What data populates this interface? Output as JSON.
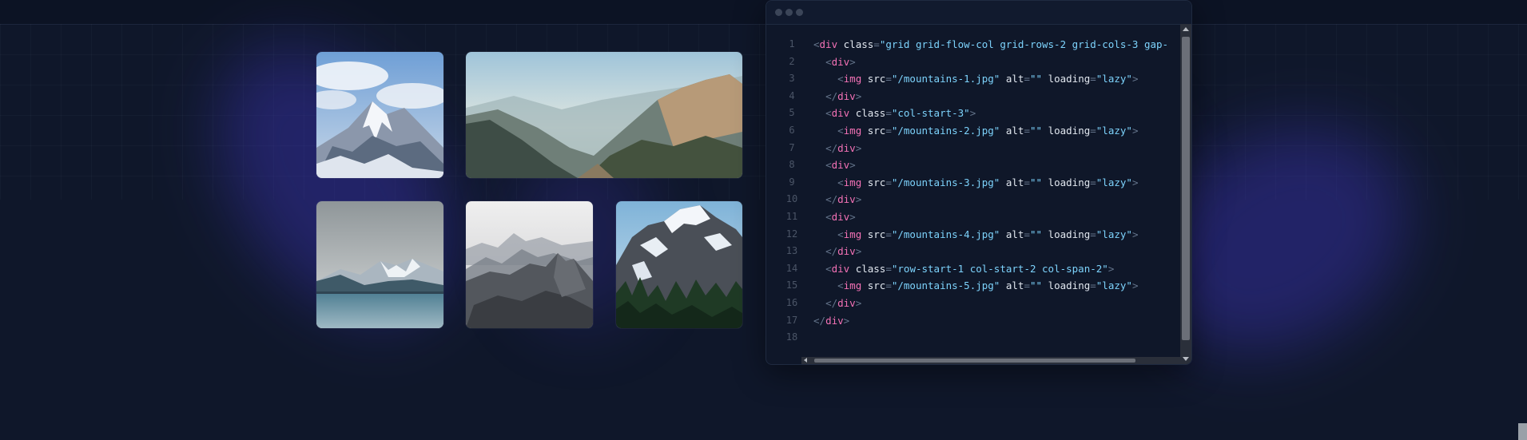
{
  "gallery": {
    "images": [
      {
        "name": "mountains-1",
        "description": "snow-capped peak under cloudy blue sky"
      },
      {
        "name": "mountains-2",
        "description": "sunlit mountain valley panorama"
      },
      {
        "name": "mountains-3",
        "description": "lake with distant snowy mountains"
      },
      {
        "name": "mountains-4",
        "description": "misty rocky ridge"
      },
      {
        "name": "mountains-5",
        "description": "snowy peak above pine forest"
      }
    ]
  },
  "editor": {
    "lines": [
      {
        "n": "1",
        "tokens": [
          [
            "punc",
            "<"
          ],
          [
            "tag",
            "div"
          ],
          [
            "sp",
            " "
          ],
          [
            "attr",
            "class"
          ],
          [
            "eq",
            "="
          ],
          [
            "str",
            "\"grid grid-flow-col grid-rows-2 grid-cols-3 gap-"
          ]
        ]
      },
      {
        "n": "2",
        "tokens": [
          [
            "sp",
            "  "
          ],
          [
            "punc",
            "<"
          ],
          [
            "tag",
            "div"
          ],
          [
            "punc",
            ">"
          ]
        ]
      },
      {
        "n": "3",
        "tokens": [
          [
            "sp",
            "    "
          ],
          [
            "punc",
            "<"
          ],
          [
            "tag",
            "img"
          ],
          [
            "sp",
            " "
          ],
          [
            "attr",
            "src"
          ],
          [
            "eq",
            "="
          ],
          [
            "str",
            "\"/mountains-1.jpg\""
          ],
          [
            "sp",
            " "
          ],
          [
            "attr",
            "alt"
          ],
          [
            "eq",
            "="
          ],
          [
            "str",
            "\"\""
          ],
          [
            "sp",
            " "
          ],
          [
            "attr",
            "loading"
          ],
          [
            "eq",
            "="
          ],
          [
            "str",
            "\"lazy\""
          ],
          [
            "punc",
            ">"
          ]
        ]
      },
      {
        "n": "4",
        "tokens": [
          [
            "sp",
            "  "
          ],
          [
            "punc",
            "</"
          ],
          [
            "tag",
            "div"
          ],
          [
            "punc",
            ">"
          ]
        ]
      },
      {
        "n": "5",
        "tokens": [
          [
            "sp",
            "  "
          ],
          [
            "punc",
            "<"
          ],
          [
            "tag",
            "div"
          ],
          [
            "sp",
            " "
          ],
          [
            "attr",
            "class"
          ],
          [
            "eq",
            "="
          ],
          [
            "str",
            "\"col-start-3\""
          ],
          [
            "punc",
            ">"
          ]
        ]
      },
      {
        "n": "6",
        "tokens": [
          [
            "sp",
            "    "
          ],
          [
            "punc",
            "<"
          ],
          [
            "tag",
            "img"
          ],
          [
            "sp",
            " "
          ],
          [
            "attr",
            "src"
          ],
          [
            "eq",
            "="
          ],
          [
            "str",
            "\"/mountains-2.jpg\""
          ],
          [
            "sp",
            " "
          ],
          [
            "attr",
            "alt"
          ],
          [
            "eq",
            "="
          ],
          [
            "str",
            "\"\""
          ],
          [
            "sp",
            " "
          ],
          [
            "attr",
            "loading"
          ],
          [
            "eq",
            "="
          ],
          [
            "str",
            "\"lazy\""
          ],
          [
            "punc",
            ">"
          ]
        ]
      },
      {
        "n": "7",
        "tokens": [
          [
            "sp",
            "  "
          ],
          [
            "punc",
            "</"
          ],
          [
            "tag",
            "div"
          ],
          [
            "punc",
            ">"
          ]
        ]
      },
      {
        "n": "8",
        "tokens": [
          [
            "sp",
            "  "
          ],
          [
            "punc",
            "<"
          ],
          [
            "tag",
            "div"
          ],
          [
            "punc",
            ">"
          ]
        ]
      },
      {
        "n": "9",
        "tokens": [
          [
            "sp",
            "    "
          ],
          [
            "punc",
            "<"
          ],
          [
            "tag",
            "img"
          ],
          [
            "sp",
            " "
          ],
          [
            "attr",
            "src"
          ],
          [
            "eq",
            "="
          ],
          [
            "str",
            "\"/mountains-3.jpg\""
          ],
          [
            "sp",
            " "
          ],
          [
            "attr",
            "alt"
          ],
          [
            "eq",
            "="
          ],
          [
            "str",
            "\"\""
          ],
          [
            "sp",
            " "
          ],
          [
            "attr",
            "loading"
          ],
          [
            "eq",
            "="
          ],
          [
            "str",
            "\"lazy\""
          ],
          [
            "punc",
            ">"
          ]
        ]
      },
      {
        "n": "10",
        "tokens": [
          [
            "sp",
            "  "
          ],
          [
            "punc",
            "</"
          ],
          [
            "tag",
            "div"
          ],
          [
            "punc",
            ">"
          ]
        ]
      },
      {
        "n": "11",
        "tokens": [
          [
            "sp",
            "  "
          ],
          [
            "punc",
            "<"
          ],
          [
            "tag",
            "div"
          ],
          [
            "punc",
            ">"
          ]
        ]
      },
      {
        "n": "12",
        "tokens": [
          [
            "sp",
            "    "
          ],
          [
            "punc",
            "<"
          ],
          [
            "tag",
            "img"
          ],
          [
            "sp",
            " "
          ],
          [
            "attr",
            "src"
          ],
          [
            "eq",
            "="
          ],
          [
            "str",
            "\"/mountains-4.jpg\""
          ],
          [
            "sp",
            " "
          ],
          [
            "attr",
            "alt"
          ],
          [
            "eq",
            "="
          ],
          [
            "str",
            "\"\""
          ],
          [
            "sp",
            " "
          ],
          [
            "attr",
            "loading"
          ],
          [
            "eq",
            "="
          ],
          [
            "str",
            "\"lazy\""
          ],
          [
            "punc",
            ">"
          ]
        ]
      },
      {
        "n": "13",
        "tokens": [
          [
            "sp",
            "  "
          ],
          [
            "punc",
            "</"
          ],
          [
            "tag",
            "div"
          ],
          [
            "punc",
            ">"
          ]
        ]
      },
      {
        "n": "14",
        "tokens": [
          [
            "sp",
            "  "
          ],
          [
            "punc",
            "<"
          ],
          [
            "tag",
            "div"
          ],
          [
            "sp",
            " "
          ],
          [
            "attr",
            "class"
          ],
          [
            "eq",
            "="
          ],
          [
            "str",
            "\"row-start-1 col-start-2 col-span-2\""
          ],
          [
            "punc",
            ">"
          ]
        ]
      },
      {
        "n": "15",
        "tokens": [
          [
            "sp",
            "    "
          ],
          [
            "punc",
            "<"
          ],
          [
            "tag",
            "img"
          ],
          [
            "sp",
            " "
          ],
          [
            "attr",
            "src"
          ],
          [
            "eq",
            "="
          ],
          [
            "str",
            "\"/mountains-5.jpg\""
          ],
          [
            "sp",
            " "
          ],
          [
            "attr",
            "alt"
          ],
          [
            "eq",
            "="
          ],
          [
            "str",
            "\"\""
          ],
          [
            "sp",
            " "
          ],
          [
            "attr",
            "loading"
          ],
          [
            "eq",
            "="
          ],
          [
            "str",
            "\"lazy\""
          ],
          [
            "punc",
            ">"
          ]
        ]
      },
      {
        "n": "16",
        "tokens": [
          [
            "sp",
            "  "
          ],
          [
            "punc",
            "</"
          ],
          [
            "tag",
            "div"
          ],
          [
            "punc",
            ">"
          ]
        ]
      },
      {
        "n": "17",
        "tokens": [
          [
            "punc",
            "</"
          ],
          [
            "tag",
            "div"
          ],
          [
            "punc",
            ">"
          ]
        ]
      },
      {
        "n": "18",
        "tokens": []
      }
    ]
  },
  "colors": {
    "background": "#0f172a",
    "glow": "#4338ca",
    "tag": "#f472b6",
    "string": "#7dd3fc",
    "attribute": "#e2e8f0"
  }
}
